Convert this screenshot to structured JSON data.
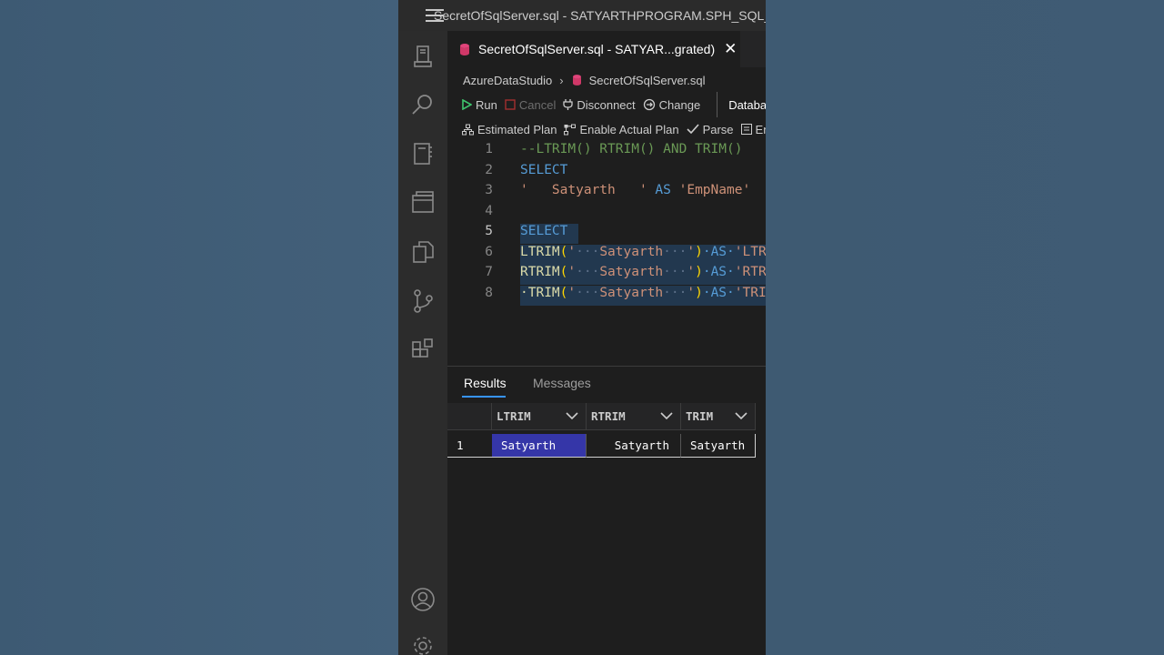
{
  "window": {
    "title": "SecretOfSqlServer.sql - SATYARTHPROGRAM.SPH_SQL_"
  },
  "tab": {
    "title": "SecretOfSqlServer.sql - SATYAR...grated)",
    "close": "✕"
  },
  "breadcrumb": {
    "root": "AzureDataStudio",
    "file": "SecretOfSqlServer.sql"
  },
  "toolbar": {
    "run": "Run",
    "cancel": "Cancel",
    "disconnect": "Disconnect",
    "change": "Change",
    "database": "Databas",
    "estimated_plan": "Estimated Plan",
    "enable_actual_plan": "Enable Actual Plan",
    "parse": "Parse",
    "enable": "Enab"
  },
  "editor": {
    "line_numbers": [
      "1",
      "2",
      "3",
      "4",
      "5",
      "6",
      "7",
      "8"
    ],
    "current_line": 5,
    "lines": [
      [
        {
          "t": "--LTRIM() RTRIM() AND TRIM()",
          "c": "cm"
        }
      ],
      [
        {
          "t": "SELECT",
          "c": "k"
        }
      ],
      [
        {
          "t": "'   Satyarth   '",
          "c": "s"
        },
        {
          "t": " AS ",
          "c": "k"
        },
        {
          "t": "'EmpName'",
          "c": "s"
        }
      ],
      [],
      [
        {
          "t": "SELECT",
          "c": "k"
        }
      ],
      [
        {
          "t": "LTRIM",
          "c": "f"
        },
        {
          "t": "(",
          "c": "p"
        },
        {
          "t": "'",
          "c": "s"
        },
        {
          "t": "···",
          "c": "dot"
        },
        {
          "t": "Satyarth",
          "c": "s"
        },
        {
          "t": "···",
          "c": "dot"
        },
        {
          "t": "'",
          "c": "s"
        },
        {
          "t": ")",
          "c": "p"
        },
        {
          "t": "·AS·",
          "c": "k"
        },
        {
          "t": "'LTRIM'",
          "c": "s"
        }
      ],
      [
        {
          "t": "RTRIM",
          "c": "f"
        },
        {
          "t": "(",
          "c": "p"
        },
        {
          "t": "'",
          "c": "s"
        },
        {
          "t": "···",
          "c": "dot"
        },
        {
          "t": "Satyarth",
          "c": "s"
        },
        {
          "t": "···",
          "c": "dot"
        },
        {
          "t": "'",
          "c": "s"
        },
        {
          "t": ")",
          "c": "p"
        },
        {
          "t": "·AS·",
          "c": "k"
        },
        {
          "t": "'RTRIM'",
          "c": "s"
        }
      ],
      [
        {
          "t": "·TRIM",
          "c": "f"
        },
        {
          "t": "(",
          "c": "p"
        },
        {
          "t": "'",
          "c": "s"
        },
        {
          "t": "···",
          "c": "dot"
        },
        {
          "t": "Satyarth",
          "c": "s"
        },
        {
          "t": "···",
          "c": "dot"
        },
        {
          "t": "'",
          "c": "s"
        },
        {
          "t": ")",
          "c": "p"
        },
        {
          "t": "·AS·",
          "c": "k"
        },
        {
          "t": "'TRIM'",
          "c": "s"
        }
      ]
    ]
  },
  "results": {
    "tabs": [
      "Results",
      "Messages"
    ],
    "columns": [
      "LTRIM",
      "RTRIM",
      "TRIM"
    ],
    "rows": [
      {
        "num": "1",
        "cells": [
          "Satyarth",
          "Satyarth",
          "Satyarth"
        ]
      }
    ]
  },
  "colors": {
    "accent": "#3794ff",
    "selected_cell": "#3536a8",
    "keyword": "#569cd6",
    "string": "#ce9178",
    "comment": "#6a9955"
  }
}
